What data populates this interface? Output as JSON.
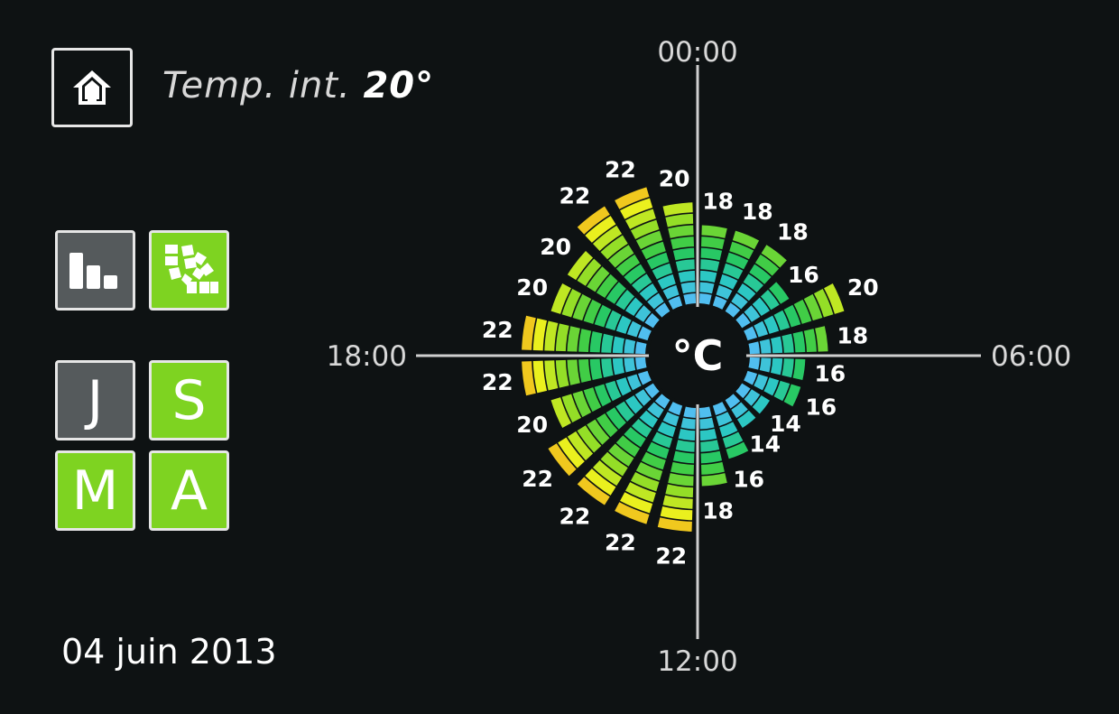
{
  "header": {
    "temp_label": "Temp. int.",
    "temp_value": "20°"
  },
  "home_button": {
    "icon": "home-icon"
  },
  "view_buttons": {
    "stats": {
      "icon": "bar-chart-icon",
      "active": false
    },
    "radial": {
      "icon": "radial-chart-icon",
      "active": true
    }
  },
  "period_buttons": {
    "day": {
      "label": "J",
      "active": false
    },
    "week": {
      "label": "S",
      "active": true
    },
    "month": {
      "label": "M",
      "active": true
    },
    "year": {
      "label": "A",
      "active": true
    }
  },
  "date": "04 juin 2013",
  "colors": {
    "background": "#0e1213",
    "accent_green": "#7ed321",
    "inactive_gray": "#555a5c",
    "tile_border": "#e6e6e6",
    "axis_line": "#cfcfcf"
  },
  "chart_data": {
    "type": "radial-bar",
    "center_label": "°C",
    "axis_labels": {
      "top": "00:00",
      "right": "06:00",
      "bottom": "12:00",
      "left": "18:00"
    },
    "segment_scale": [
      12,
      23
    ],
    "hours": [
      "00",
      "01",
      "02",
      "03",
      "04",
      "05",
      "06",
      "07",
      "08",
      "09",
      "10",
      "11",
      "12",
      "13",
      "14",
      "15",
      "16",
      "17",
      "18",
      "19",
      "20",
      "21",
      "22",
      "23"
    ],
    "values": [
      18,
      18,
      18,
      16,
      20,
      18,
      16,
      16,
      14,
      14,
      16,
      18,
      22,
      22,
      22,
      22,
      20,
      22,
      22,
      20,
      20,
      22,
      22,
      20
    ]
  }
}
